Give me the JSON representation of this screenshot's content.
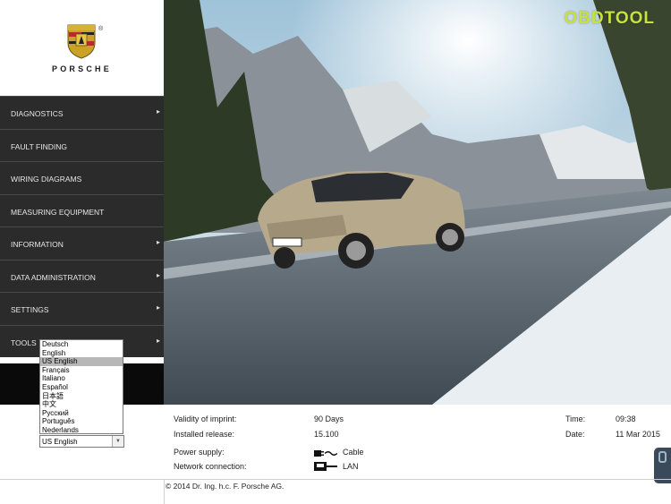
{
  "brand": {
    "wordmark": "PORSCHE",
    "registered": "®"
  },
  "watermark": "OBDTOOL",
  "nav": {
    "items": [
      {
        "label": "DIAGNOSTICS",
        "arrow": "▸"
      },
      {
        "label": "FAULT FINDING",
        "arrow": ""
      },
      {
        "label": "WIRING DIAGRAMS",
        "arrow": ""
      },
      {
        "label": "MEASURING EQUIPMENT",
        "arrow": ""
      },
      {
        "label": "INFORMATION",
        "arrow": "▸"
      },
      {
        "label": "DATA ADMINISTRATION",
        "arrow": "▸"
      },
      {
        "label": "SETTINGS",
        "arrow": "▸"
      },
      {
        "label": "TOOLS",
        "arrow": "▸"
      }
    ]
  },
  "language": {
    "options": [
      "Deutsch",
      "English",
      "US English",
      "Français",
      "Italiano",
      "Español",
      "日本語",
      "中文",
      "Русский",
      "Português",
      "Nederlands"
    ],
    "selected": "US English"
  },
  "info": {
    "validity_label": "Validity of imprint:",
    "validity_value": "90 Days",
    "release_label": "Installed release:",
    "release_value": "15.100",
    "power_label": "Power supply:",
    "power_value": "Cable",
    "network_label": "Network connection:",
    "network_value": "LAN",
    "time_label": "Time:",
    "time_value": "09:38",
    "date_label": "Date:",
    "date_value": "11 Mar 2015"
  },
  "copyright": "© 2014 Dr. Ing. h.c. F. Porsche AG."
}
